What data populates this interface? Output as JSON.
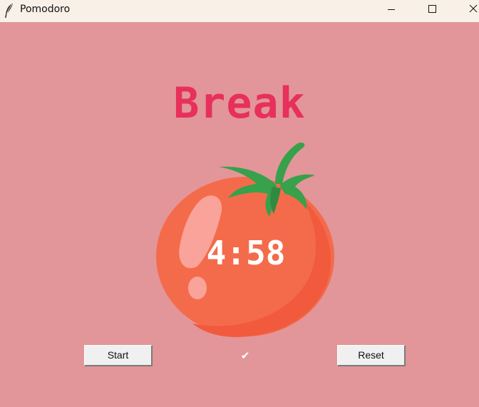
{
  "window": {
    "title": "Pomodoro",
    "app_icon": "feather-icon",
    "controls": {
      "minimize": "minimize-icon",
      "maximize": "maximize-icon",
      "close": "close-icon"
    }
  },
  "main": {
    "heading": "Break",
    "timer": "4:58",
    "checkmarks": "✔",
    "start_label": "Start",
    "reset_label": "Reset",
    "tomato_image": "tomato-icon"
  },
  "colors": {
    "background": "#e29699",
    "heading": "#e7305b",
    "titlebar": "#f9f1e7",
    "timer_text": "#ffffff"
  }
}
